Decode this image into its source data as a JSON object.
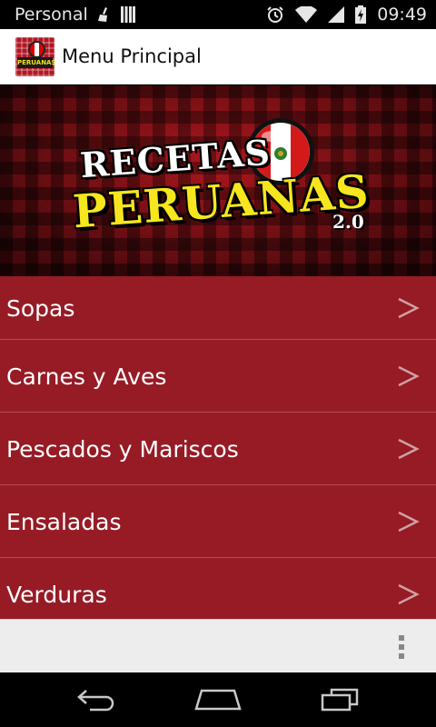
{
  "status_bar": {
    "carrier": "Personal",
    "time": "09:49",
    "icons": [
      "broom-icon",
      "signal-bars-icon",
      "alarm-icon",
      "wifi-icon",
      "network-signal-icon",
      "battery-charging-icon"
    ]
  },
  "action_bar": {
    "title": "Menu Principal",
    "logo_text": "PERUANAS"
  },
  "banner": {
    "title_line1": "RECETAS",
    "title_line2": "PERUANAS",
    "version": "2.0"
  },
  "menu": {
    "items": [
      {
        "label": "Sopas"
      },
      {
        "label": "Carnes y Aves"
      },
      {
        "label": "Pescados y Mariscos"
      },
      {
        "label": "Ensaladas"
      },
      {
        "label": "Verduras"
      }
    ],
    "chevron": ">"
  },
  "nav_bar": {
    "buttons": [
      "back-icon",
      "home-icon",
      "recent-apps-icon"
    ]
  },
  "colors": {
    "menu_background": "#961b25",
    "menu_divider": "#b84a53",
    "title_yellow": "#f7e61e",
    "options_bar": "#ededed"
  }
}
